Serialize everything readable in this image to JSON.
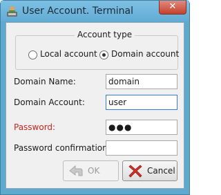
{
  "window": {
    "title": "User Account. Terminal...",
    "close_label": "✕"
  },
  "account_type": {
    "legend": "Account type",
    "options": [
      {
        "label": "Local account",
        "checked": false
      },
      {
        "label": "Domain account",
        "checked": true
      }
    ]
  },
  "fields": {
    "domain_name": {
      "label": "Domain Name:",
      "value": "domain"
    },
    "domain_account": {
      "label": "Domain Account:",
      "value": "user"
    },
    "password": {
      "label": "Password:",
      "value": "●●●"
    },
    "password_confirmation": {
      "label": "Password confirmation:",
      "value": ""
    }
  },
  "buttons": {
    "ok": {
      "label": "OK",
      "enabled": false
    },
    "cancel": {
      "label": "Cancel",
      "enabled": true
    }
  },
  "colors": {
    "titlebar": "#62acd5",
    "close_button": "#c4412f",
    "error_label": "#c8241f",
    "focus_border": "#3a7bd0"
  }
}
